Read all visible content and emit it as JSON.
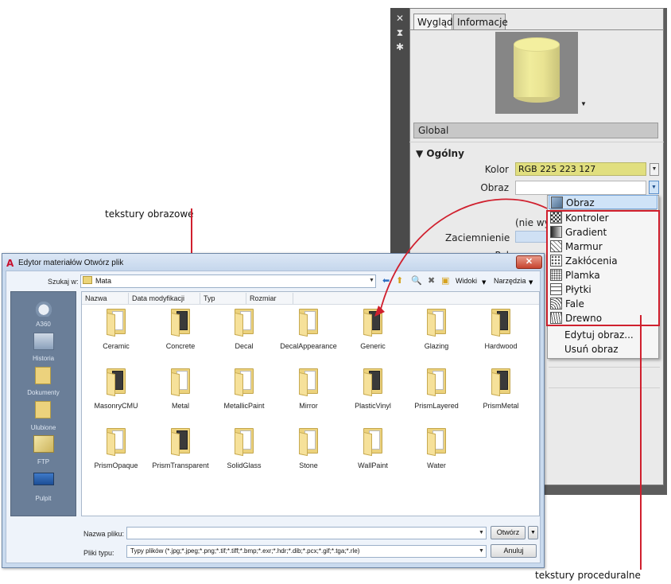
{
  "palette": {
    "tabs": [
      "Wygląd",
      "Informacje"
    ],
    "strip_icons": [
      "close-icon",
      "autohide-icon",
      "settings-icon"
    ],
    "global_label": "Global",
    "section_title": "Ogólny",
    "color_label": "Kolor",
    "color_value": "RGB 225 223 127",
    "image_label": "Obraz",
    "hidden_value": "(nie wy",
    "shading_label": "Zaciemnienie",
    "partial_label": "Poł"
  },
  "menu": {
    "selected": "Obraz",
    "procedural_items": [
      "Kontroler",
      "Gradient",
      "Marmur",
      "Zakłócenia",
      "Plamka",
      "Płytki",
      "Fale",
      "Drewno"
    ],
    "actions": [
      "Edytuj obraz...",
      "Usuń obraz"
    ]
  },
  "dialog": {
    "title": "Edytor materiałów Otwórz plik",
    "look_in_label": "Szukaj w:",
    "look_in_value": "Mata",
    "toolbar_views": "Widoki",
    "toolbar_tools": "Narzędzia",
    "places": [
      "A360",
      "Historia",
      "Dokumenty",
      "Ulubione",
      "FTP",
      "Pulpit"
    ],
    "columns": [
      "Nazwa",
      "Data modyfikacji",
      "Typ",
      "Rozmiar"
    ],
    "folders": [
      "Ceramic",
      "Concrete",
      "Decal",
      "DecalAppearance",
      "Generic",
      "Glazing",
      "Hardwood",
      "MasonryCMU",
      "Metal",
      "MetallicPaint",
      "Mirror",
      "PlasticVinyl",
      "PrismLayered",
      "PrismMetal",
      "PrismOpaque",
      "PrismTransparent",
      "SolidGlass",
      "Stone",
      "WallPaint",
      "Water"
    ],
    "filename_label": "Nazwa pliku:",
    "filename_value": "",
    "filetype_label": "Pliki typu:",
    "filetype_value": "Typy plików  (*.jpg;*.jpeg;*.png;*.tif;*.tiff;*.bmp;*.exr;*.hdr;*.dib;*.pcx;*.gif;*.tga;*.rle)",
    "open_button": "Otwórz",
    "cancel_button": "Anuluj"
  },
  "annotations": {
    "image_textures": "tekstury obrazowe",
    "procedural_textures": "tekstury proceduralne"
  },
  "colors": {
    "annotation_red": "#d0202e",
    "material_color": "#e1df7f"
  }
}
